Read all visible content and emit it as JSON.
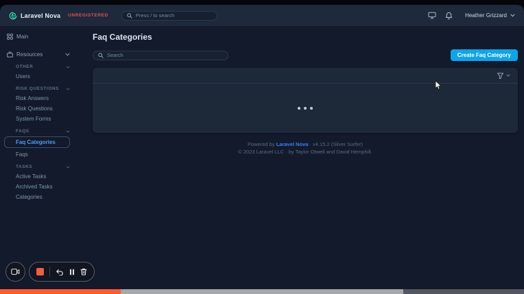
{
  "topbar": {
    "brand": "Laravel Nova",
    "license_badge": "UNREGISTERED",
    "search_placeholder": "Press / to search",
    "user_name": "Heather Grizzard"
  },
  "sidebar": {
    "main_label": "Main",
    "resources_label": "Resources",
    "sections": [
      {
        "label": "OTHER",
        "items": [
          "Users"
        ]
      },
      {
        "label": "RISK QUESTIONS",
        "items": [
          "Risk Answers",
          "Risk Questions",
          "System Forms"
        ]
      },
      {
        "label": "FAQS",
        "items": [
          "Faq Categories",
          "Faqs"
        ]
      },
      {
        "label": "TASKS",
        "items": [
          "Active Tasks",
          "Archived Tasks",
          "Categories"
        ]
      }
    ],
    "active_item": "Faq Categories"
  },
  "main": {
    "page_title": "Faq Categories",
    "search_placeholder": "Search",
    "create_button_label": "Create Faq Category",
    "loading_state": "loading-dots"
  },
  "footer": {
    "powered_prefix": "Powered by ",
    "powered_link": "Laravel Nova",
    "version_suffix": " · v4.15.2 (Silver Surfer)",
    "copyright": "© 2023 Laravel LLC · by Taylor Otwell and David Hemphill."
  },
  "recorder": {
    "timeline_played_pct": 23,
    "timeline_loaded_pct": 77
  },
  "icons": {
    "nova-logo-icon": "teal spiral",
    "search-icon": "magnifier",
    "monitor-icon": "desktop display",
    "bell-icon": "notifications",
    "chevron-down-icon": "expand",
    "grid-icon": "main dashboard",
    "briefcase-icon": "resources",
    "filter-icon": "funnel",
    "cursor-icon": "mouse pointer",
    "camera-icon": "video camera",
    "stop-icon": "stop recording",
    "undo-icon": "restart",
    "pause-icon": "pause",
    "trash-icon": "discard"
  },
  "colors": {
    "page_bg": "#121a2b",
    "panel_bg": "#1d2839",
    "topbar_bg": "#1e2a3b",
    "accent_blue": "#0da5e9",
    "active_link_blue": "#4b9ef9",
    "footer_link_blue": "#3b82f6",
    "unregistered_red": "#e0504e",
    "logo_teal": "#2ad1a3",
    "record_orange": "#f25c40",
    "scrubber_orange": "#fe5b32",
    "scrubber_gray": "#a7a7a7",
    "scrubber_dark": "#53565c"
  }
}
